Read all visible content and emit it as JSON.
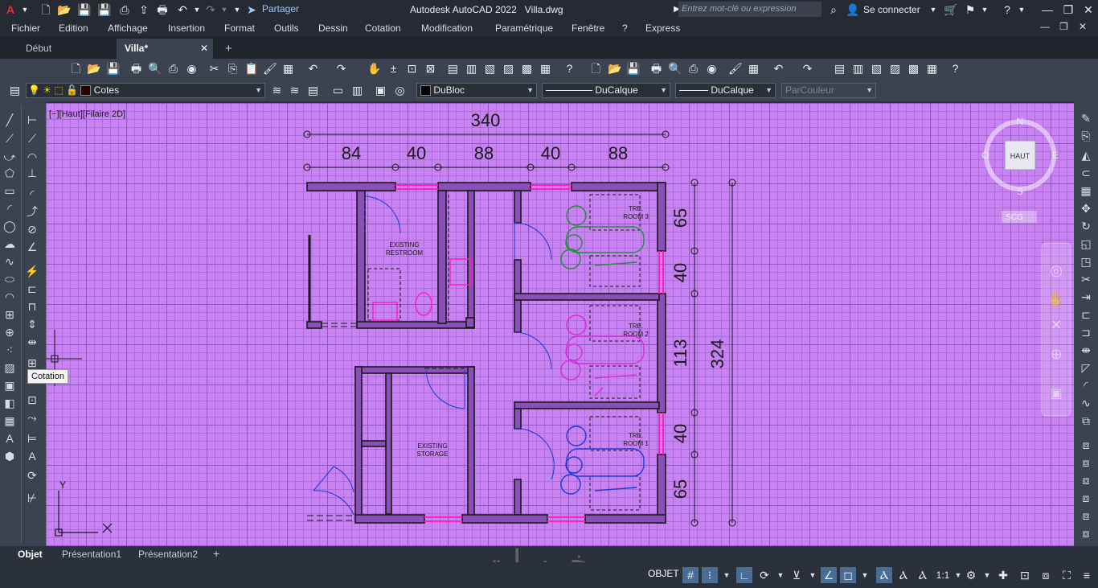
{
  "titlebar": {
    "app_icon": "A",
    "share_label": "Partager",
    "app_name": "Autodesk AutoCAD 2022",
    "file_name": "Villa.dwg",
    "search_placeholder": "Entrez mot-clé ou expression",
    "signin_label": "Se connecter",
    "icons": [
      "new-icon",
      "open-icon",
      "save-icon",
      "save-as-icon",
      "publish-icon",
      "plot-icon",
      "undo-icon",
      "redo-icon",
      "share-icon",
      "search-icon",
      "user-icon",
      "cart-icon",
      "help-icon",
      "minimize-icon",
      "restore-icon",
      "close-icon"
    ]
  },
  "menu": {
    "items": [
      "Fichier",
      "Edition",
      "Affichage",
      "Insertion",
      "Format",
      "Outils",
      "Dessin",
      "Cotation",
      "Modification",
      "Paramétrique",
      "Fenêtre",
      "?",
      "Express"
    ]
  },
  "tabs": {
    "items": [
      "Début",
      "Villa*"
    ],
    "active": "Villa*"
  },
  "properties": {
    "layer": "Cotes",
    "color": "DuBloc",
    "linetype": "DuCalque",
    "lineweight": "DuCalque",
    "plotstyle": "ParCouleur"
  },
  "canvas": {
    "view_label": "[−][Haut][Filaire 2D]",
    "tooltip": "Cotation",
    "viewcube": {
      "face": "HAUT",
      "north": "N",
      "south": "S",
      "east": "E",
      "west": "O",
      "ucs": "SCG"
    },
    "ucs_x": "X",
    "ucs_y": "Y",
    "colors": {
      "background": "#c882f2",
      "walls": "#1a1a1a",
      "windows": "#ff1fbd",
      "blue": "#1a3bd6",
      "green": "#1f8f3a",
      "magenta": "#d92bd9"
    }
  },
  "drawing": {
    "dim_top_total": "340",
    "dim_top_segments": [
      "84",
      "40",
      "88",
      "40",
      "88"
    ],
    "dim_right_segments": [
      "65",
      "40",
      "113",
      "40",
      "65"
    ],
    "dim_right_total": "324",
    "rooms": {
      "restroom": [
        "EXISTING",
        "RESTROOM"
      ],
      "storage": [
        "EXISTING",
        "STORAGE"
      ],
      "room3": [
        "TRE.",
        "ROOM 3"
      ],
      "room2": [
        "TRE.",
        "ROOM 2"
      ],
      "room1": [
        "TRE.",
        "ROOM 1"
      ]
    }
  },
  "layout_tabs": {
    "items": [
      "Objet",
      "Présentation1",
      "Présentation2"
    ],
    "active": "Objet"
  },
  "statusbar": {
    "model_label": "OBJET",
    "scale": "1:1"
  },
  "watermark": "خمسات"
}
